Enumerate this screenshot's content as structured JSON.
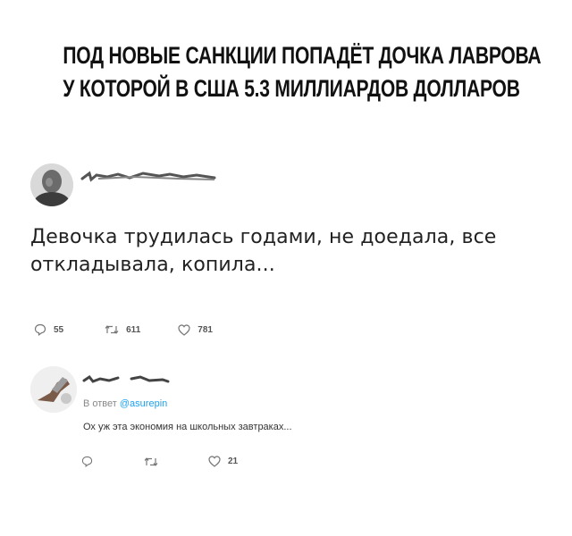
{
  "headline": {
    "line1": "ПОД НОВЫЕ САНКЦИИ ПОПАДЁТ ДОЧКА ЛАВРОВА",
    "line2": "У КОТОРОЙ В США 5.3 МИЛЛИАРДОВ ДОЛЛАРОВ"
  },
  "tweet": {
    "text_line1": "Девочка трудилась годами, не доедала, все",
    "text_line2": "откладывала, копила...",
    "replies": "55",
    "retweets": "611",
    "likes": "781"
  },
  "reply": {
    "reply_prefix": "В ответ",
    "reply_handle": "@asurepin",
    "text": "Ох уж эта экономия на школьных завтраках...",
    "replies": "",
    "retweets": "",
    "likes": "21"
  },
  "icons": {
    "reply": "reply-icon",
    "retweet": "retweet-icon",
    "like": "heart-icon"
  }
}
